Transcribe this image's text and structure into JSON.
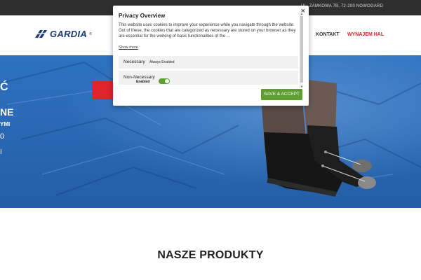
{
  "topbar": {
    "address": "UL. ZAMKOWA 7B, 72-200 NOWOGARD"
  },
  "header": {
    "logo_text": "GARDIA",
    "logo_reg": "®",
    "nav": {
      "kontakt": "KONTAKT",
      "wynajem": "WYNAJEM HAL"
    },
    "colors": {
      "brand": "#1b3a74",
      "accent": "#d3252a"
    }
  },
  "hero": {
    "partial_text": [
      "Ć",
      "NE",
      "YMI",
      "0",
      "I"
    ],
    "cta_color": "#e1232d"
  },
  "section": {
    "title": "NASZE PRODUKTY"
  },
  "cookie_modal": {
    "title": "Privacy Overview",
    "text": "This website uses cookies to improve your experience while you navigate through the website. Out of these, the cookies that are categorized as necessary are stored on your browser as they are essential for the working of basic functionalities of the ...",
    "show_more": "Show more",
    "close_icon": "×",
    "necessary": {
      "label": "Necessary",
      "status": "Always Enabled"
    },
    "non_necessary": {
      "label": "Non-Necessary",
      "toggle_label": "Enabled"
    },
    "accept_label": "SAVE & ACCEPT",
    "colors": {
      "accept": "#5da02f"
    }
  }
}
